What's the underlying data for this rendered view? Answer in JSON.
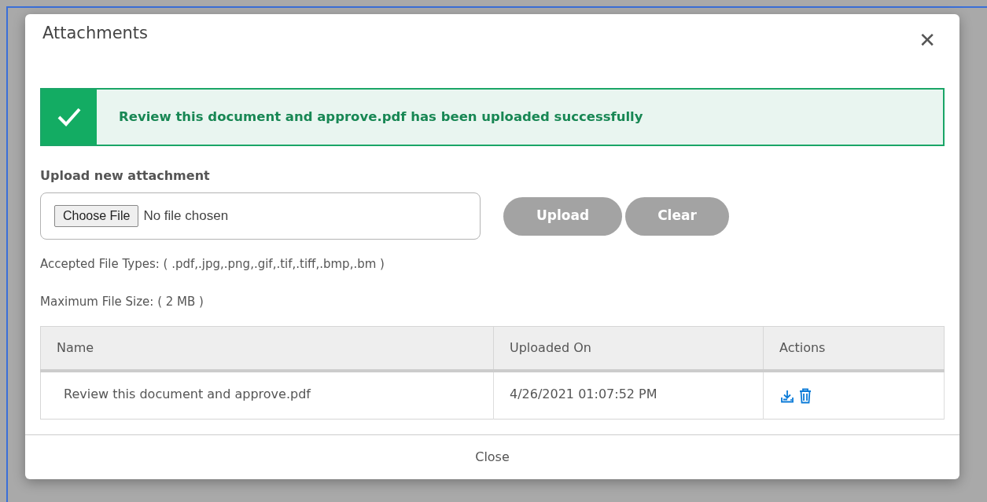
{
  "dialog": {
    "title": "Attachments",
    "close_symbol": "✕"
  },
  "alert": {
    "kind": "success",
    "message": "Review this document and approve.pdf has been uploaded successfully"
  },
  "upload": {
    "label": "Upload new attachment",
    "choose_button": "Choose File",
    "file_status": "No file chosen",
    "buttons": [
      {
        "label": "Upload",
        "disabled": true
      },
      {
        "label": "Clear",
        "disabled": true
      }
    ],
    "notes": [
      "Accepted File Types: ( .pdf,.jpg,.png,.gif,.tif,.tiff,.bmp,.bm )",
      "Maximum File Size: ( 2 MB )"
    ]
  },
  "table": {
    "columns": [
      "Name",
      "Uploaded On",
      "Actions"
    ],
    "rows": [
      {
        "name": "Review this document and approve.pdf",
        "uploaded_on": "4/26/2021 01:07:52 PM"
      }
    ]
  },
  "footer": {
    "button": "Close"
  }
}
